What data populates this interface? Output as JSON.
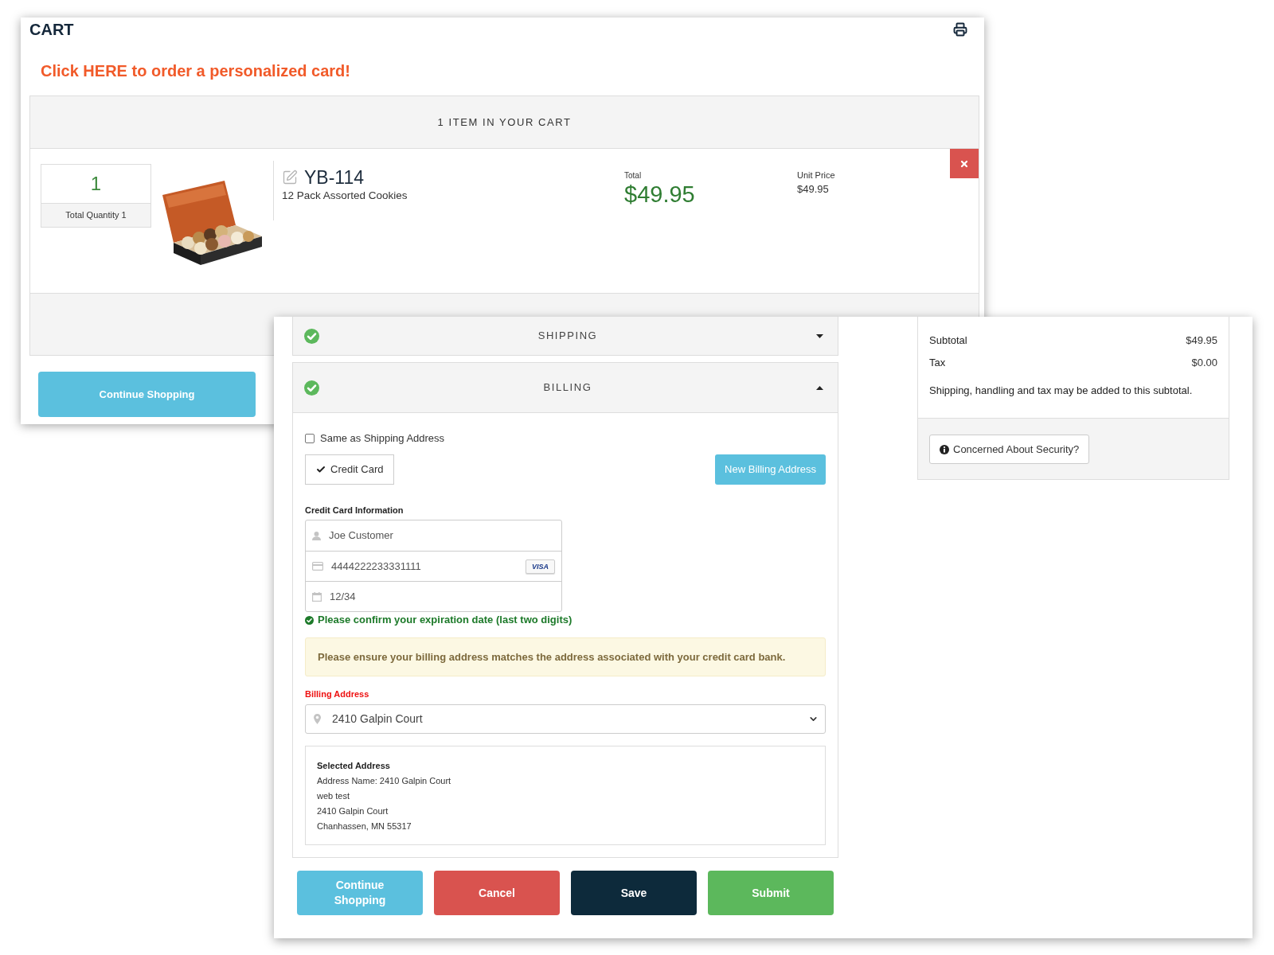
{
  "cart_window": {
    "title": "CART",
    "promo_link": "Click HERE to order a personalized card!",
    "cart_panel": {
      "heading": "1 ITEM IN YOUR CART",
      "items": [
        {
          "quantity": "1",
          "quantity_label": "Total Quantity 1",
          "sku": "YB-114",
          "description": "12 Pack Assorted Cookies",
          "total_label": "Total",
          "total": "$49.95",
          "unit_price_label": "Unit Price",
          "unit_price": "$49.95"
        }
      ]
    },
    "continue_button": "Continue Shopping"
  },
  "checkout_window": {
    "sections": [
      {
        "title": "SHIPPING",
        "complete": true,
        "expanded": false
      },
      {
        "title": "BILLING",
        "complete": true,
        "expanded": true
      }
    ],
    "billing": {
      "same_as_shipping": {
        "label": "Same as Shipping Address",
        "checked": false
      },
      "payment_method": {
        "label": "Credit Card",
        "selected": true
      },
      "new_address_button": "New Billing Address",
      "card_info": {
        "label": "Credit Card Information",
        "name": "Joe Customer",
        "number": "4444222233331111",
        "card_brand": "VISA",
        "expiry": "12/34"
      },
      "expiry_notice": "Please confirm your expiration date (last two digits)",
      "alert": "Please ensure your billing address matches the address associated with your credit card bank.",
      "address_label": "Billing Address",
      "address_select": "2410 Galpin Court",
      "selected_address": {
        "heading": "Selected Address",
        "lines": [
          "Address Name: 2410 Galpin Court",
          "web test",
          "2410 Galpin Court",
          "Chanhassen, MN 55317"
        ]
      }
    },
    "buttons": [
      {
        "label": "Continue Shopping",
        "kind": "info"
      },
      {
        "label": "Cancel",
        "kind": "danger"
      },
      {
        "label": "Save",
        "kind": "dark"
      },
      {
        "label": "Submit",
        "kind": "success"
      }
    ],
    "summary": {
      "rows": [
        {
          "label": "Subtotal",
          "value": "$49.95"
        },
        {
          "label": "Tax",
          "value": "$0.00"
        }
      ],
      "note": "Shipping, handling and tax may be added to this subtotal.",
      "security_button": "Concerned About Security?"
    }
  }
}
